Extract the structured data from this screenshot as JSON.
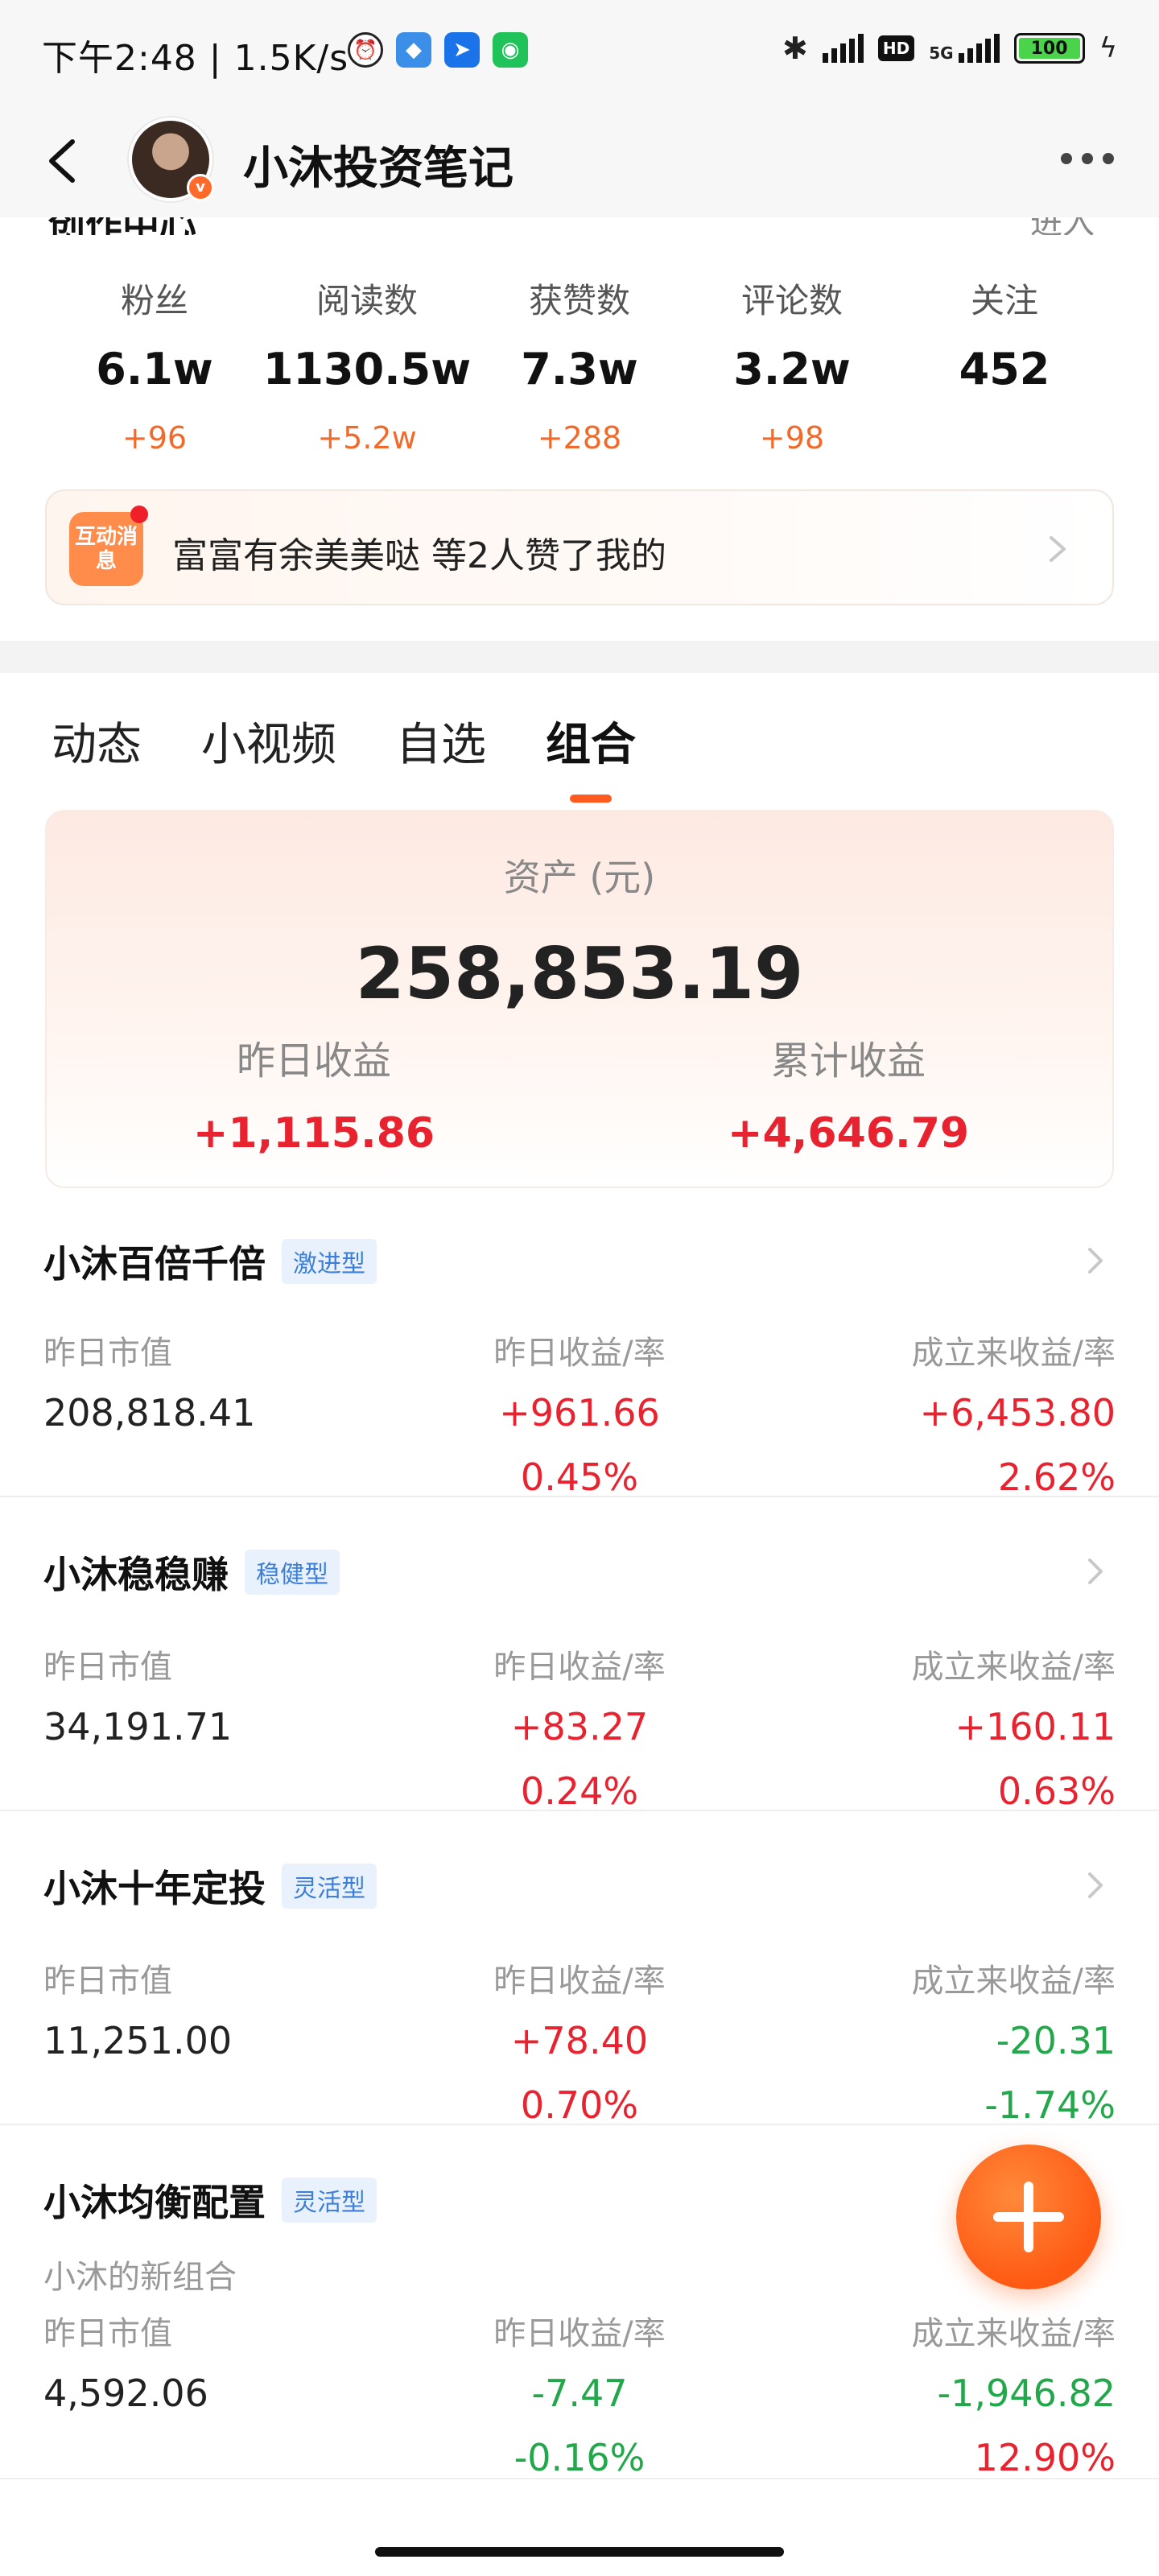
{
  "status_bar": {
    "time": "下午2:48 | 1.5K/s",
    "hd": "HD",
    "network": "5G",
    "battery": "100"
  },
  "nav": {
    "title": "小沐投资笔记",
    "avatar_badge": "v"
  },
  "header_partial": {
    "left": "创作中心",
    "right": "进入"
  },
  "stats": [
    {
      "label": "粉丝",
      "value": "6.1w",
      "delta": "+96"
    },
    {
      "label": "阅读数",
      "value": "1130.5w",
      "delta": "+5.2w"
    },
    {
      "label": "获赞数",
      "value": "7.3w",
      "delta": "+288"
    },
    {
      "label": "评论数",
      "value": "3.2w",
      "delta": "+98"
    },
    {
      "label": "关注",
      "value": "452",
      "delta": ""
    }
  ],
  "notice": {
    "icon_text": "互动消息",
    "text": "富富有余美美哒 等2人赞了我的"
  },
  "tabs": [
    {
      "label": "动态"
    },
    {
      "label": "小视频"
    },
    {
      "label": "自选"
    },
    {
      "label": "组合"
    }
  ],
  "assets": {
    "label": "资产 (元)",
    "value": "258,853.19",
    "yesterday_label": "昨日收益",
    "yesterday_value": "+1,115.86",
    "total_label": "累计收益",
    "total_value": "+4,646.79"
  },
  "column_headers": {
    "c1": "昨日市值",
    "c2": "昨日收益/率",
    "c3": "成立来收益/率"
  },
  "portfolios": [
    {
      "name": "小沐百倍千倍",
      "tag": "激进型",
      "sub": "",
      "market_value": "208,818.41",
      "day_gain": "+961.66",
      "day_rate": "0.45%",
      "total_gain": "+6,453.80",
      "total_rate": "2.62%"
    },
    {
      "name": "小沐稳稳赚",
      "tag": "稳健型",
      "sub": "",
      "market_value": "34,191.71",
      "day_gain": "+83.27",
      "day_rate": "0.24%",
      "total_gain": "+160.11",
      "total_rate": "0.63%"
    },
    {
      "name": "小沐十年定投",
      "tag": "灵活型",
      "sub": "",
      "market_value": "11,251.00",
      "day_gain": "+78.40",
      "day_rate": "0.70%",
      "total_gain": "-20.31",
      "total_rate": "-1.74%"
    },
    {
      "name": "小沐均衡配置",
      "tag": "灵活型",
      "sub": "小沐的新组合",
      "market_value": "4,592.06",
      "day_gain": "-7.47",
      "day_rate": "-0.16%",
      "total_gain": "-1,946.82",
      "total_rate": "12.90%"
    }
  ],
  "colors": {
    "accent": "#ff5a1f",
    "gain": "#e8222e",
    "loss": "#22a84a",
    "tag_blue": "#3d7fd6"
  }
}
